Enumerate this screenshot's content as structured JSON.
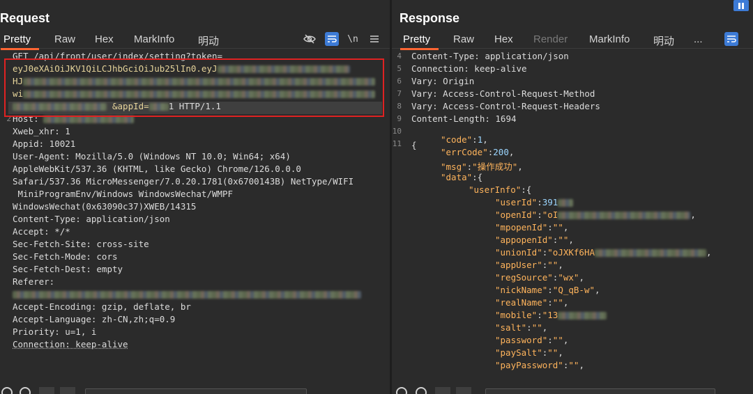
{
  "request": {
    "title": "Request",
    "tabs": [
      "Pretty",
      "Raw",
      "Hex",
      "MarkInfo",
      "明动"
    ],
    "toolbar_newline": "\\n",
    "lines": [
      {
        "num": "",
        "text": "GET /api/front/user/index/setting?token="
      },
      {
        "num": "",
        "text": "eyJ0eXAiOiJKV1QiLCJhbGciOiJub25lIn0.eyJ"
      },
      {
        "num": "",
        "text": "HJ"
      },
      {
        "num": "",
        "text": "wi"
      },
      {
        "num": "",
        "text": "&appId="
      },
      {
        "num": "2",
        "text": "Host:"
      },
      {
        "num": "",
        "text": "Xweb_xhr: 1"
      },
      {
        "num": "",
        "text": "Appid: 10021"
      },
      {
        "num": "",
        "text": "User-Agent: Mozilla/5.0 (Windows NT 10.0; Win64; x64)"
      },
      {
        "num": "",
        "text": "AppleWebKit/537.36 (KHTML, like Gecko) Chrome/126.0.0.0"
      },
      {
        "num": "",
        "text": "Safari/537.36 MicroMessenger/7.0.20.1781(0x6700143B) NetType/WIFI"
      },
      {
        "num": "",
        "text": " MiniProgramEnv/Windows WindowsWechat/WMPF"
      },
      {
        "num": "",
        "text": "WindowsWechat(0x63090c37)XWEB/14315"
      },
      {
        "num": "",
        "text": "Content-Type: application/json"
      },
      {
        "num": "",
        "text": "Accept: */*"
      },
      {
        "num": "",
        "text": "Sec-Fetch-Site: cross-site"
      },
      {
        "num": "",
        "text": "Sec-Fetch-Mode: cors"
      },
      {
        "num": "",
        "text": "Sec-Fetch-Dest: empty"
      },
      {
        "num": "",
        "text": "Referer:"
      },
      {
        "num": "",
        "text": ""
      },
      {
        "num": "",
        "text": "Accept-Encoding: gzip, deflate, br"
      },
      {
        "num": "",
        "text": "Accept-Language: zh-CN,zh;q=0.9"
      },
      {
        "num": "",
        "text": "Priority: u=1, i"
      },
      {
        "num": "",
        "text": "Connection: keep-alive"
      }
    ],
    "request_line_suffix": "HTTP/1.1",
    "appid_suffix": "1"
  },
  "response": {
    "title": "Response",
    "tabs": [
      "Pretty",
      "Raw",
      "Hex",
      "Render",
      "MarkInfo",
      "明动",
      "..."
    ],
    "headers": [
      {
        "num": "4",
        "text": "Content-Type: application/json"
      },
      {
        "num": "5",
        "text": "Connection: keep-alive"
      },
      {
        "num": "6",
        "text": "Vary: Origin"
      },
      {
        "num": "7",
        "text": "Vary: Access-Control-Request-Method"
      },
      {
        "num": "8",
        "text": "Vary: Access-Control-Request-Headers"
      },
      {
        "num": "9",
        "text": "Content-Length: 1694"
      },
      {
        "num": "10",
        "text": ""
      },
      {
        "num": "11",
        "text": "{"
      }
    ],
    "json": {
      "code": "\"code\"",
      "code_val": "1",
      "errCode": "\"errCode\"",
      "errCode_val": "200",
      "msg": "\"msg\"",
      "msg_val": "\"操作成功\"",
      "data": "\"data\"",
      "userInfo": "\"userInfo\"",
      "userId": "\"userId\"",
      "userId_val": "391",
      "openId": "\"openId\"",
      "openId_val": "\"oI",
      "mpopenId": "\"mpopenId\"",
      "appopenId": "\"appopenId\"",
      "unionId": "\"unionId\"",
      "unionId_val": "\"oJXKf6HA",
      "appUser": "\"appUser\"",
      "regSource": "\"regSource\"",
      "regSource_val": "\"wx\"",
      "nickName": "\"nickName\"",
      "nickName_val": "\"Q_qB-w\"",
      "realName": "\"realName\"",
      "mobile": "\"mobile\"",
      "mobile_val": "\"13",
      "salt": "\"salt\"",
      "password": "\"password\"",
      "paySalt": "\"paySalt\"",
      "payPassword": "\"payPassword\"",
      "empty": "\"\""
    }
  }
}
